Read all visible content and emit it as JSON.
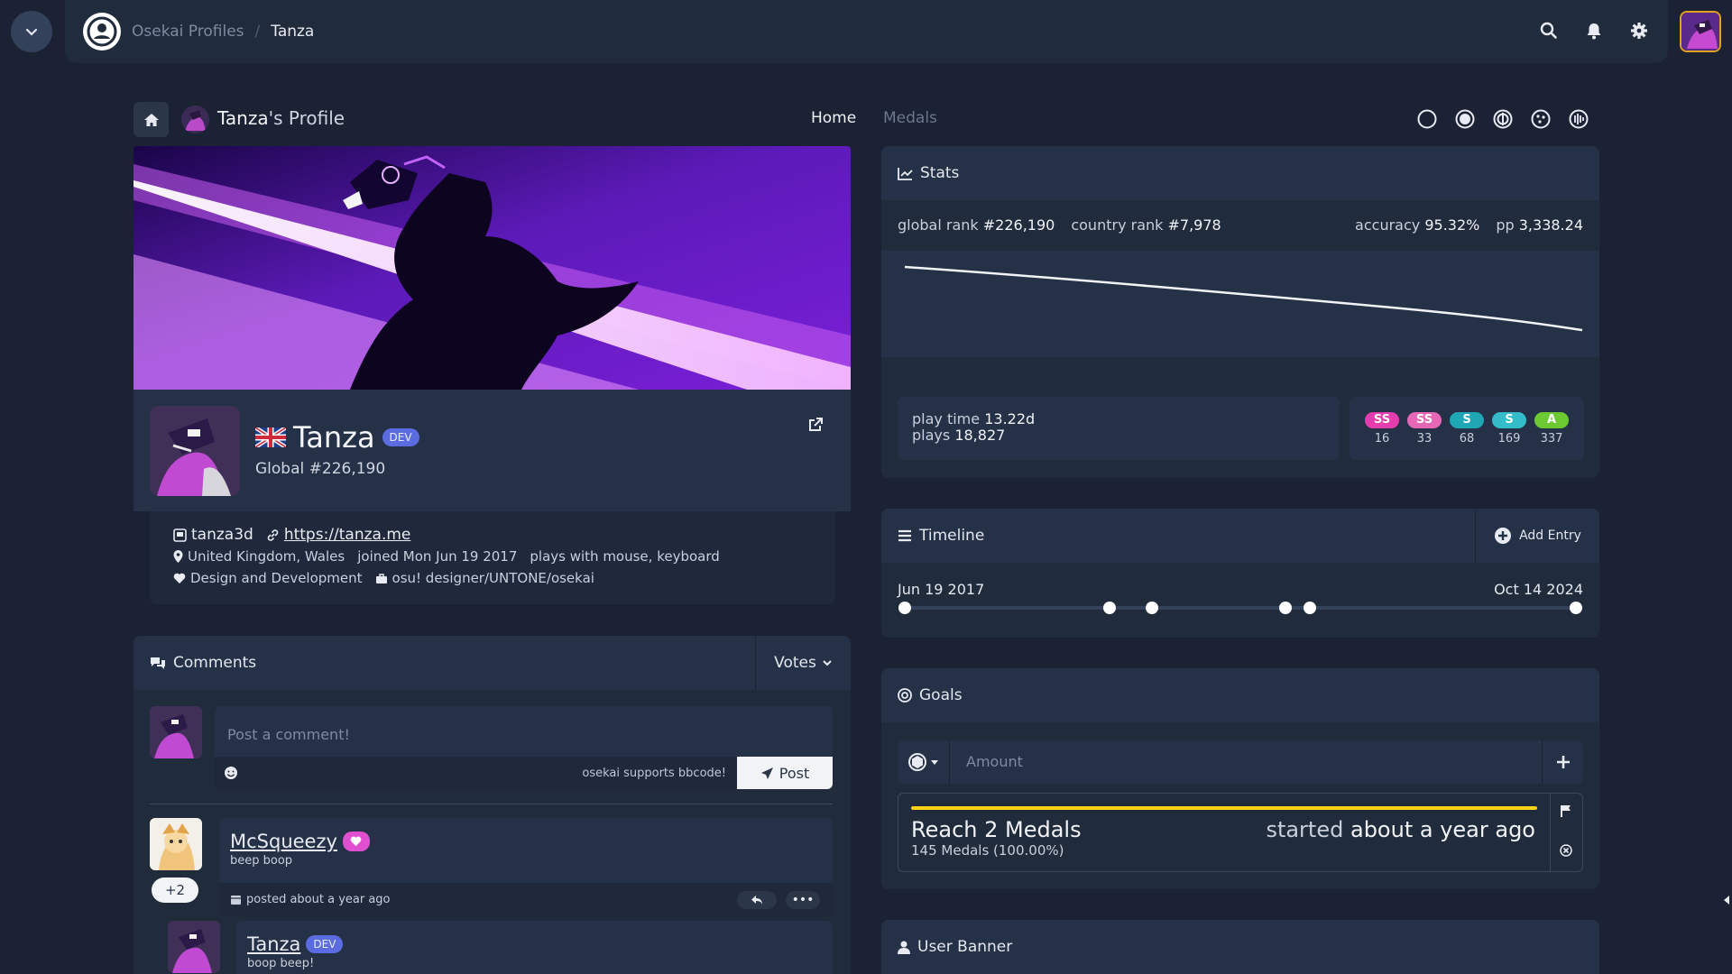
{
  "topbar": {
    "breadcrumb": [
      "Osekai Profiles",
      "Tanza"
    ],
    "breadcrumb_sep": "/",
    "icons": [
      "search-icon",
      "bell-icon",
      "gear-icon"
    ]
  },
  "profile_header": {
    "name": "Tanza",
    "suffix": "'s Profile",
    "nav": [
      "Home",
      "Medals"
    ],
    "active_nav": "Home",
    "mode_icons": [
      "osu-mode-icon",
      "taiko-mode-icon",
      "catch-mode-icon",
      "mania-mode-icon",
      "all-modes-icon"
    ]
  },
  "user": {
    "name": "Tanza",
    "badge": "DEV",
    "country": "United Kingdom",
    "global_rank": "Global #226,190",
    "discord": "tanza3d",
    "website": "https://tanza.me",
    "location": "United Kingdom, Wales",
    "joined": "joined Mon Jun 19 2017",
    "plays_with": "plays with mouse, keyboard",
    "interests": "Design and Development",
    "occupation": "osu! designer/UNTONE/osekai"
  },
  "comments": {
    "title": "Comments",
    "sort": "Votes",
    "placeholder": "Post a comment!",
    "bbcode_note": "osekai supports bbcode!",
    "post_label": "Post",
    "items": [
      {
        "author": "McSqueezy",
        "subtitle": "beep boop",
        "posted": "posted about a year ago",
        "votes": "+2",
        "more": "•••"
      },
      {
        "author": "Tanza",
        "badge": "DEV",
        "subtitle": "boop beep!"
      }
    ]
  },
  "stats": {
    "title": "Stats",
    "global_rank_label": "global rank",
    "global_rank": "#226,190",
    "country_rank_label": "country rank",
    "country_rank": "#7,978",
    "accuracy_label": "accuracy",
    "accuracy": "95.32%",
    "pp_label": "pp",
    "pp": "3,338.24",
    "play_time_label": "play time",
    "play_time": "13.22d",
    "plays_label": "plays",
    "plays": "18,827",
    "grades": [
      {
        "label": "SS",
        "count": "16",
        "color": "#e63dae"
      },
      {
        "label": "SS",
        "count": "33",
        "color": "#e667b6"
      },
      {
        "label": "S",
        "count": "68",
        "color": "#1fa7b5"
      },
      {
        "label": "S",
        "count": "169",
        "color": "#34bcc8"
      },
      {
        "label": "A",
        "count": "337",
        "color": "#6cc932"
      }
    ]
  },
  "timeline": {
    "title": "Timeline",
    "add_label": "Add Entry",
    "start": "Jun 19 2017",
    "end": "Oct 14 2024",
    "points": [
      0.0,
      0.305,
      0.368,
      0.567,
      0.603,
      1.0
    ]
  },
  "goals": {
    "title": "Goals",
    "amount_placeholder": "Amount",
    "goal_name": "Reach 2 Medals",
    "goal_sub": "145 Medals (100.00%)",
    "started_prefix": "started",
    "started_when": "about a year ago",
    "progress": 1.0
  },
  "user_banner": {
    "title": "User Banner"
  },
  "colors": {
    "accent": "#5b6be0",
    "bg": "#1a2233",
    "panel": "#202b3c",
    "goal_bar": "#ffd21a"
  }
}
